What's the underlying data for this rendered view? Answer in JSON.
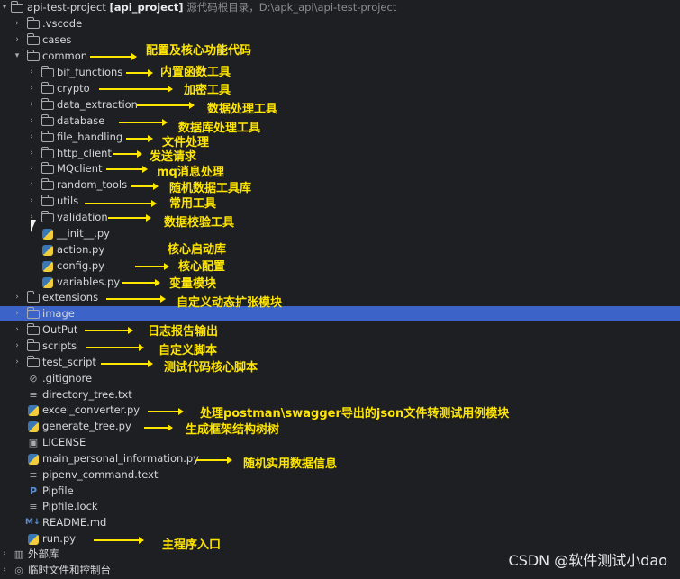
{
  "root": {
    "name": "api-test-project",
    "module": "[api_project]",
    "path_label": "源代码根目录，D:\\apk_api\\api-test-project"
  },
  "items": [
    {
      "label": ".vscode",
      "icon": "folder-icon"
    },
    {
      "label": "cases",
      "icon": "folder-icon"
    },
    {
      "label": "common",
      "icon": "folder-icon",
      "expanded": true
    },
    {
      "label": "bif_functions",
      "icon": "folder-icon"
    },
    {
      "label": "crypto",
      "icon": "folder-icon"
    },
    {
      "label": "data_extraction",
      "icon": "folder-icon"
    },
    {
      "label": "database",
      "icon": "folder-icon"
    },
    {
      "label": "file_handling",
      "icon": "folder-icon"
    },
    {
      "label": "http_client",
      "icon": "folder-icon"
    },
    {
      "label": "MQclient",
      "icon": "folder-icon"
    },
    {
      "label": "random_tools",
      "icon": "folder-icon"
    },
    {
      "label": "utils",
      "icon": "folder-icon"
    },
    {
      "label": "validation",
      "icon": "folder-icon"
    },
    {
      "label": "__init__.py",
      "icon": "python-file-icon"
    },
    {
      "label": "action.py",
      "icon": "python-file-icon"
    },
    {
      "label": "config.py",
      "icon": "python-file-icon"
    },
    {
      "label": "variables.py",
      "icon": "python-file-icon"
    },
    {
      "label": "extensions",
      "icon": "folder-icon"
    },
    {
      "label": "image",
      "icon": "folder-icon",
      "selected": true
    },
    {
      "label": "OutPut",
      "icon": "folder-icon"
    },
    {
      "label": "scripts",
      "icon": "folder-icon"
    },
    {
      "label": "test_script",
      "icon": "folder-icon"
    },
    {
      "label": ".gitignore",
      "icon": "ignore-file-icon"
    },
    {
      "label": "directory_tree.txt",
      "icon": "text-file-icon"
    },
    {
      "label": "excel_converter.py",
      "icon": "python-file-icon"
    },
    {
      "label": "generate_tree.py",
      "icon": "python-file-icon"
    },
    {
      "label": "LICENSE",
      "icon": "license-file-icon"
    },
    {
      "label": "main_personal_information.py",
      "icon": "python-file-icon"
    },
    {
      "label": "pipenv_command.text",
      "icon": "text-file-icon"
    },
    {
      "label": "Pipfile",
      "icon": "pipfile-icon"
    },
    {
      "label": "Pipfile.lock",
      "icon": "text-file-icon"
    },
    {
      "label": "README.md",
      "icon": "markdown-file-icon"
    },
    {
      "label": "run.py",
      "icon": "python-file-icon"
    }
  ],
  "bottom": {
    "external_libs": "外部库",
    "scratches": "临时文件和控制台"
  },
  "annotations": {
    "common": "配置及核心功能代码",
    "bif_functions": "内置函数工具",
    "crypto": "加密工具",
    "data_extraction": "数据处理工具",
    "database": "数据库处理工具",
    "file_handling": "文件处理",
    "http_client": "发送请求",
    "mqclient": "mq消息处理",
    "random_tools": "随机数据工具库",
    "utils": "常用工具",
    "validation": "数据校验工具",
    "action": "核心启动库",
    "config": "核心配置",
    "variables": "变量模块",
    "extensions": "自定义动态扩张模块",
    "output": "日志报告输出",
    "scripts": "自定义脚本",
    "test_script": "测试代码核心脚本",
    "excel_converter": "处理postman\\swagger导出的json文件转测试用例模块",
    "generate_tree": "生成框架结构树树",
    "main_personal_information": "随机实用数据信息",
    "run": "主程序入口"
  },
  "watermark": "CSDN @软件测试小dao",
  "colors": {
    "background": "#1e1f22",
    "selection": "#3c64c8",
    "annotation": "#ffe600",
    "text": "#d4d6da"
  }
}
